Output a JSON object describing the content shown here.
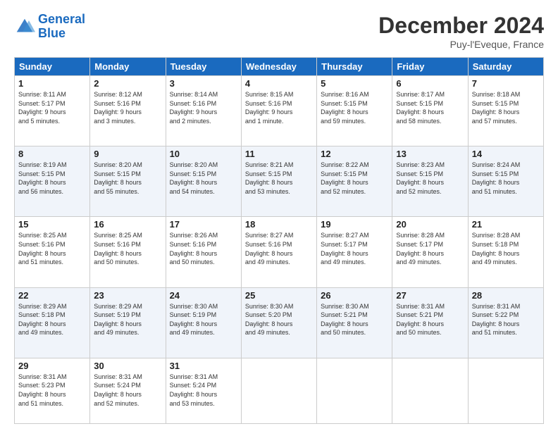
{
  "header": {
    "logo_line1": "General",
    "logo_line2": "Blue",
    "title": "December 2024",
    "location": "Puy-l'Eveque, France"
  },
  "days_of_week": [
    "Sunday",
    "Monday",
    "Tuesday",
    "Wednesday",
    "Thursday",
    "Friday",
    "Saturday"
  ],
  "weeks": [
    [
      {
        "day": "1",
        "info": "Sunrise: 8:11 AM\nSunset: 5:17 PM\nDaylight: 9 hours\nand 5 minutes."
      },
      {
        "day": "2",
        "info": "Sunrise: 8:12 AM\nSunset: 5:16 PM\nDaylight: 9 hours\nand 3 minutes."
      },
      {
        "day": "3",
        "info": "Sunrise: 8:14 AM\nSunset: 5:16 PM\nDaylight: 9 hours\nand 2 minutes."
      },
      {
        "day": "4",
        "info": "Sunrise: 8:15 AM\nSunset: 5:16 PM\nDaylight: 9 hours\nand 1 minute."
      },
      {
        "day": "5",
        "info": "Sunrise: 8:16 AM\nSunset: 5:15 PM\nDaylight: 8 hours\nand 59 minutes."
      },
      {
        "day": "6",
        "info": "Sunrise: 8:17 AM\nSunset: 5:15 PM\nDaylight: 8 hours\nand 58 minutes."
      },
      {
        "day": "7",
        "info": "Sunrise: 8:18 AM\nSunset: 5:15 PM\nDaylight: 8 hours\nand 57 minutes."
      }
    ],
    [
      {
        "day": "8",
        "info": "Sunrise: 8:19 AM\nSunset: 5:15 PM\nDaylight: 8 hours\nand 56 minutes."
      },
      {
        "day": "9",
        "info": "Sunrise: 8:20 AM\nSunset: 5:15 PM\nDaylight: 8 hours\nand 55 minutes."
      },
      {
        "day": "10",
        "info": "Sunrise: 8:20 AM\nSunset: 5:15 PM\nDaylight: 8 hours\nand 54 minutes."
      },
      {
        "day": "11",
        "info": "Sunrise: 8:21 AM\nSunset: 5:15 PM\nDaylight: 8 hours\nand 53 minutes."
      },
      {
        "day": "12",
        "info": "Sunrise: 8:22 AM\nSunset: 5:15 PM\nDaylight: 8 hours\nand 52 minutes."
      },
      {
        "day": "13",
        "info": "Sunrise: 8:23 AM\nSunset: 5:15 PM\nDaylight: 8 hours\nand 52 minutes."
      },
      {
        "day": "14",
        "info": "Sunrise: 8:24 AM\nSunset: 5:15 PM\nDaylight: 8 hours\nand 51 minutes."
      }
    ],
    [
      {
        "day": "15",
        "info": "Sunrise: 8:25 AM\nSunset: 5:16 PM\nDaylight: 8 hours\nand 51 minutes."
      },
      {
        "day": "16",
        "info": "Sunrise: 8:25 AM\nSunset: 5:16 PM\nDaylight: 8 hours\nand 50 minutes."
      },
      {
        "day": "17",
        "info": "Sunrise: 8:26 AM\nSunset: 5:16 PM\nDaylight: 8 hours\nand 50 minutes."
      },
      {
        "day": "18",
        "info": "Sunrise: 8:27 AM\nSunset: 5:16 PM\nDaylight: 8 hours\nand 49 minutes."
      },
      {
        "day": "19",
        "info": "Sunrise: 8:27 AM\nSunset: 5:17 PM\nDaylight: 8 hours\nand 49 minutes."
      },
      {
        "day": "20",
        "info": "Sunrise: 8:28 AM\nSunset: 5:17 PM\nDaylight: 8 hours\nand 49 minutes."
      },
      {
        "day": "21",
        "info": "Sunrise: 8:28 AM\nSunset: 5:18 PM\nDaylight: 8 hours\nand 49 minutes."
      }
    ],
    [
      {
        "day": "22",
        "info": "Sunrise: 8:29 AM\nSunset: 5:18 PM\nDaylight: 8 hours\nand 49 minutes."
      },
      {
        "day": "23",
        "info": "Sunrise: 8:29 AM\nSunset: 5:19 PM\nDaylight: 8 hours\nand 49 minutes."
      },
      {
        "day": "24",
        "info": "Sunrise: 8:30 AM\nSunset: 5:19 PM\nDaylight: 8 hours\nand 49 minutes."
      },
      {
        "day": "25",
        "info": "Sunrise: 8:30 AM\nSunset: 5:20 PM\nDaylight: 8 hours\nand 49 minutes."
      },
      {
        "day": "26",
        "info": "Sunrise: 8:30 AM\nSunset: 5:21 PM\nDaylight: 8 hours\nand 50 minutes."
      },
      {
        "day": "27",
        "info": "Sunrise: 8:31 AM\nSunset: 5:21 PM\nDaylight: 8 hours\nand 50 minutes."
      },
      {
        "day": "28",
        "info": "Sunrise: 8:31 AM\nSunset: 5:22 PM\nDaylight: 8 hours\nand 51 minutes."
      }
    ],
    [
      {
        "day": "29",
        "info": "Sunrise: 8:31 AM\nSunset: 5:23 PM\nDaylight: 8 hours\nand 51 minutes."
      },
      {
        "day": "30",
        "info": "Sunrise: 8:31 AM\nSunset: 5:24 PM\nDaylight: 8 hours\nand 52 minutes."
      },
      {
        "day": "31",
        "info": "Sunrise: 8:31 AM\nSunset: 5:24 PM\nDaylight: 8 hours\nand 53 minutes."
      },
      {
        "day": "",
        "info": ""
      },
      {
        "day": "",
        "info": ""
      },
      {
        "day": "",
        "info": ""
      },
      {
        "day": "",
        "info": ""
      }
    ]
  ]
}
